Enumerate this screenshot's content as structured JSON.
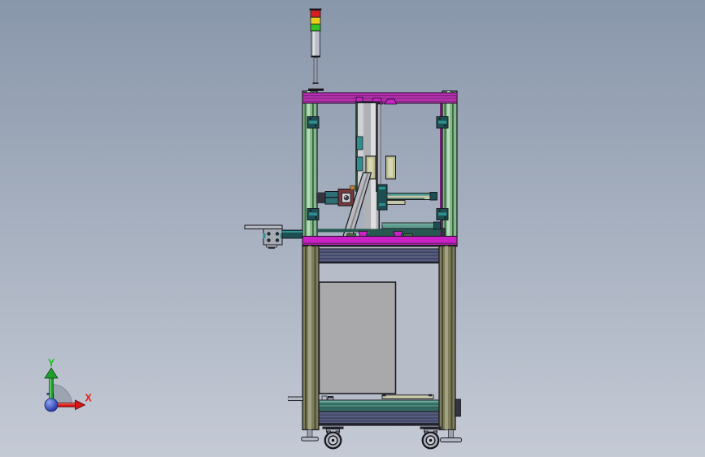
{
  "view": {
    "kind": "3d-cad-viewport"
  },
  "triad": {
    "y_label": "Y",
    "x_label": "X"
  },
  "scene": {
    "components": [
      "signal-tower-light",
      "upper-safety-enclosure",
      "vertical-actuator-column",
      "camera-arm",
      "diagonal-brace",
      "horizontal-rail",
      "outfeed-arm",
      "lower-frame",
      "control-cabinet",
      "shelf-beams",
      "swivel-casters",
      "leveling-feet"
    ]
  },
  "colors": {
    "bg_top": "#8997ab",
    "bg_bottom": "#c5cad5",
    "outline": "#15151c",
    "dark_edge": "#22222c",
    "light_red": "#d42020",
    "light_yellow": "#e8cf1e",
    "light_green": "#35c224",
    "light_body": "#b9bdc9",
    "pole_gray": "#9aa0ac",
    "frame_green": "#84b98c",
    "frame_green_dark": "#3c6444",
    "frame_green_light": "#b6dcba",
    "beam_magenta": "#b433ae",
    "beam_magenta_dark": "#7c1f78",
    "beam_magenta_bright": "#cb22c6",
    "hinge_teal": "#1d4f52",
    "sensor_teal": "#2e8f8f",
    "col_light": "#cfd0d4",
    "col_mid": "#b0b1b7",
    "col_lighter": "#dededf",
    "col_darkgreen": "#2c4636",
    "khaki": "#bdbd93",
    "khaki_light": "#d6d6b0",
    "cam_dark": "#34343e",
    "cam_teal": "#2d6f74",
    "cam_maroon": "#74393b",
    "cam_orange": "#b98034",
    "cam_lens": "#3a3a40",
    "brace_gray": "#b9babe",
    "brace_shadow": "#83848c",
    "rail_tan": "#c6c6a8",
    "tray_teal": "#5f9c8e",
    "tray_dark": "#27584f",
    "pad_green": "#3f6f3f",
    "plate_gray": "#b3b7bf",
    "plate_gray2": "#a7abb3",
    "bolt_dark": "#1d2b33",
    "beam_blue": "#585c7e",
    "beam_blue_dark": "#3a3e5e",
    "frame_olive": "#7e7e5c",
    "olive_dark": "#4a4a32",
    "olive_light": "#a2a282",
    "interior": "#b6bcc8",
    "cabinet": "#a9a9ab",
    "shelf_teal": "#4f8c80",
    "shelf_teal_dark": "#35695f",
    "shelf_teal_light": "#7ab4a6",
    "wheel": "#aeb2bc",
    "wheel_inner": "#c6cad2",
    "fork": "#8b8f99",
    "foot_disc": "#b4b8c2",
    "triad_arc": "#99a1af",
    "triad_arc_edge": "#7e8694",
    "axis_red": "#d81414",
    "axis_red_edge": "#4c0606",
    "axis_red_label": "#e32214",
    "axis_green": "#1f9e2c",
    "axis_green_edge": "#0a3c10",
    "axis_green_label": "#10c410",
    "axis_blue": "#1c2f9e",
    "axis_blue_hi": "#8fa6f2",
    "axis_navy": "#16246e"
  }
}
